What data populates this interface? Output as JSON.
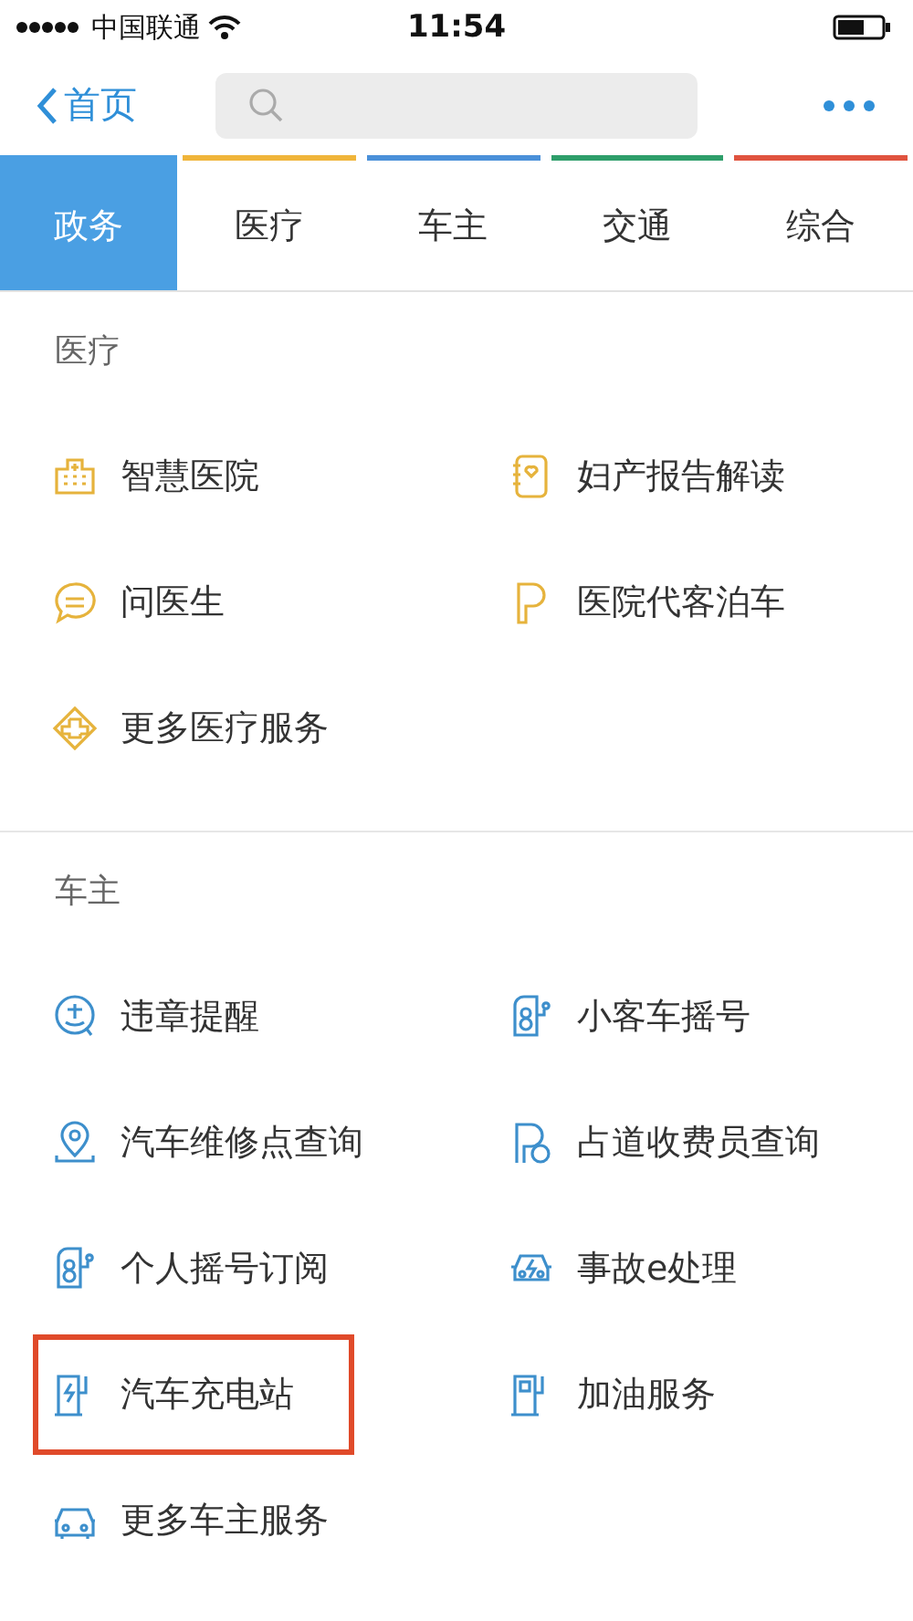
{
  "status_bar": {
    "carrier": "中国联通",
    "time": "11:54"
  },
  "nav": {
    "back": "首页"
  },
  "tabs": [
    {
      "label": "政务",
      "selected": true
    },
    {
      "label": "医疗",
      "selected": false,
      "color": "#f0b53a"
    },
    {
      "label": "车主",
      "selected": false,
      "color": "#4a90d9"
    },
    {
      "label": "交通",
      "selected": false,
      "color": "#2e9e6a"
    },
    {
      "label": "综合",
      "selected": false,
      "color": "#e0533f"
    }
  ],
  "sections": [
    {
      "title": "医疗",
      "kind": "medical",
      "items": [
        {
          "label": "智慧医院",
          "highlighted": false
        },
        {
          "label": "妇产报告解读",
          "highlighted": false
        },
        {
          "label": "问医生",
          "highlighted": false
        },
        {
          "label": "医院代客泊车",
          "highlighted": false
        },
        {
          "label": "更多医疗服务",
          "highlighted": false
        }
      ]
    },
    {
      "title": "车主",
      "kind": "car",
      "items": [
        {
          "label": "违章提醒",
          "highlighted": false
        },
        {
          "label": "小客车摇号",
          "highlighted": false
        },
        {
          "label": "汽车维修点查询",
          "highlighted": false
        },
        {
          "label": "占道收费员查询",
          "highlighted": false
        },
        {
          "label": "个人摇号订阅",
          "highlighted": false
        },
        {
          "label": "事故e处理",
          "highlighted": false
        },
        {
          "label": "汽车充电站",
          "highlighted": true
        },
        {
          "label": "加油服务",
          "highlighted": false
        },
        {
          "label": "更多车主服务",
          "highlighted": false
        }
      ]
    }
  ]
}
